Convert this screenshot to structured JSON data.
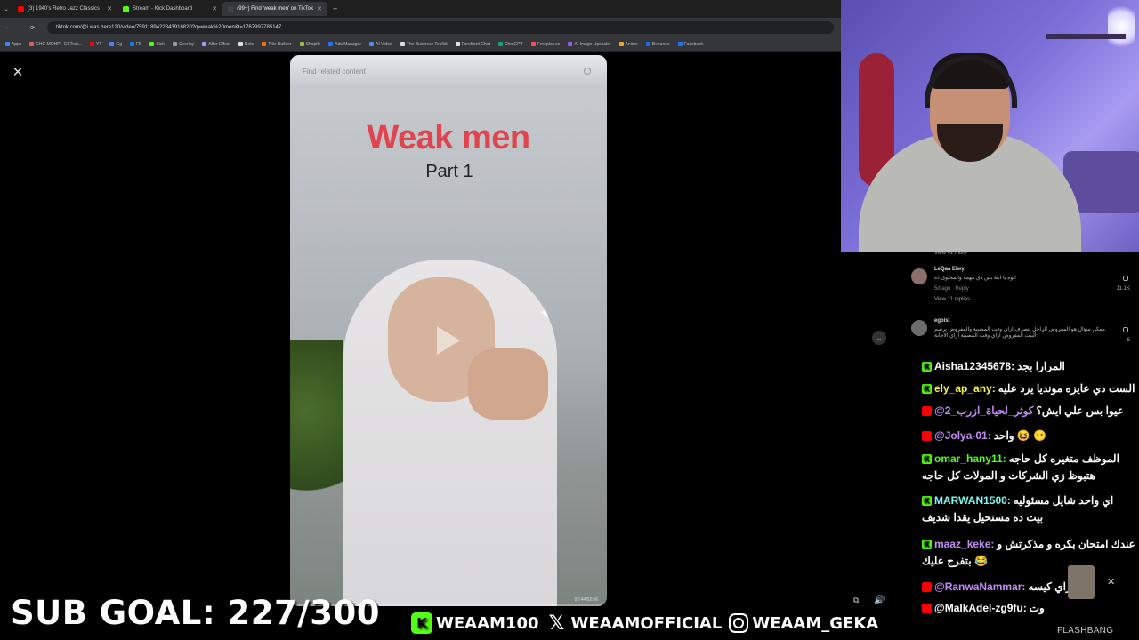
{
  "browser": {
    "tabs": [
      {
        "label": "(3) 1940's Retro Jazz Classics",
        "active": false,
        "color": "#ff0000"
      },
      {
        "label": "Stream - Kick Dashboard",
        "active": false,
        "color": "#53fc18"
      },
      {
        "label": "(99+) Find 'weak men' on TikTok",
        "active": true,
        "color": "#000000"
      }
    ],
    "url": "tiktok.com/@i.was.here120/video/7591189422343916820?q=weak%20men&t=1767997785147",
    "bookmarks": [
      "Apps",
      "EHC-MOHP - EETest...",
      "YT",
      "Gg",
      "FB",
      "Kick",
      "Overlay",
      "After Effect",
      "Note",
      "Title Builder",
      "Shopify",
      "Ads Manager",
      "AI Video",
      "The Business Toolkit",
      "Forefront Chat",
      "ChatGPT",
      "Foreplay.co",
      "AI Image Upscaler",
      "Anime",
      "Behance",
      "Facebook"
    ]
  },
  "tiktok": {
    "search_placeholder": "Find related content",
    "video_title": "Weak men",
    "video_subtitle": "Part 1",
    "timestamp": "02:44/02:56",
    "view_more": "View 41 more",
    "comments": [
      {
        "user": "LeQaa Elwy",
        "text": "ايوه يا ابلة بس دي مهمة والمحتوى ده",
        "date": "5d ago",
        "reply": "Reply",
        "likes": "11.1K",
        "replies": "View 11 replies"
      },
      {
        "user": "egoist",
        "text": "ممكن سؤال هو المفروض الراجل يتصرف ازاي وقت المصيبة والمفروض يرسم البيت المفروض ازاي وقت المصيبة ازاي الاجابة",
        "date": "5d ago",
        "reply": "Reply",
        "likes": "6",
        "replies": ""
      }
    ]
  },
  "chat": [
    {
      "platform": "kick",
      "user": "Aisha12345678:",
      "color": "#ffffff",
      "message": "المرارا بجد"
    },
    {
      "platform": "kick",
      "user": "ely_ap_any:",
      "color": "#f2f24b",
      "message": "الست دي عايزه مونديا يرد عليه"
    },
    {
      "platform": "yt",
      "user": "@2_كوثر_لحياة_ازرب",
      "color": "#c18cf5",
      "message": "عيوا بس علي ايش؟"
    },
    {
      "platform": "yt",
      "user": "@Jolya-01:",
      "color": "#c18cf5",
      "message": "واحد 😆 😶"
    },
    {
      "platform": "kick",
      "user": "omar_hany11:",
      "color": "#53fc18",
      "message": "الموظف متغيره كل حاجه"
    },
    {
      "platform": "cont",
      "user": "",
      "color": "#ffffff",
      "message": "هتبوظ زي الشركات و المولات كل حاجه"
    },
    {
      "platform": "kick",
      "user": "MARWAN1500:",
      "color": "#7ff5f0",
      "message": "اي واحد شايل مسئوليه"
    },
    {
      "platform": "cont",
      "user": "",
      "color": "#ffffff",
      "message": "بيت ده مستحيل يقدا شديف"
    },
    {
      "platform": "kick",
      "user": "maaz_keke:",
      "color": "#c18cf5",
      "message": "عندك امتحان بكره و مذكرتش و"
    },
    {
      "platform": "cont",
      "user": "",
      "color": "#ffffff",
      "message": "بتفرج عليك 😂"
    },
    {
      "platform": "yt",
      "user": "@RanwaNammar:",
      "color": "#c18cf5",
      "message": "ازاي كيسه"
    },
    {
      "platform": "yt",
      "user": "@MalkAdel-zg9fu:",
      "color": "#ffffff",
      "message": "وت"
    }
  ],
  "overlay": {
    "sub_goal": "SUB GOAL: 227/300",
    "kick_handle": "WEAAM100",
    "x_handle": "WEAAMOFFICIAL",
    "instagram_handle": "WEAAM_GEKA",
    "flashbang": "FLASHBANG"
  }
}
